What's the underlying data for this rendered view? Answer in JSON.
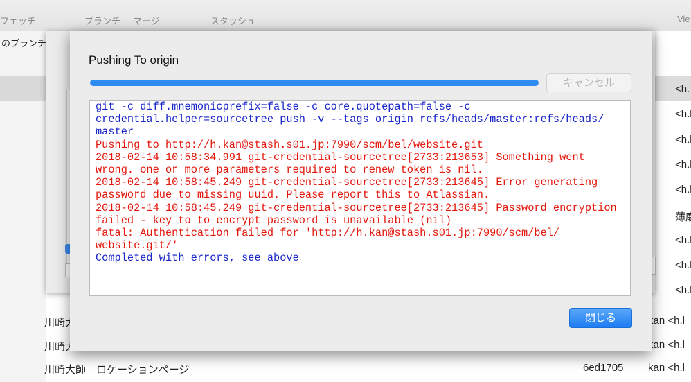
{
  "toolbar": {
    "fetch_label": "フェッチ",
    "branch_label": "ブランチ",
    "merge_label": "マージ",
    "stash_label": "スタッシュ",
    "view_label": "Vie"
  },
  "background": {
    "branch_header": "のブランチ",
    "right_authors": [
      "<h.",
      "<h.l",
      "<h.l",
      "<h.l",
      "<h.l",
      "薄磨",
      "<h.l",
      "<h.l",
      "<h.l",
      "<h.l"
    ],
    "commit_rows": [
      {
        "subject": "川崎大",
        "hash": "",
        "author": "kan <h.l"
      },
      {
        "subject": "川崎大",
        "hash": "",
        "author": "kan <h.l"
      },
      {
        "subject": "川崎大師　ロケーションページ",
        "hash": "6ed1705",
        "author": "kan <h.l"
      }
    ]
  },
  "dialog": {
    "title": "Pushing To origin",
    "progress": 1.0,
    "cancel_label": "キャンセル",
    "close_label": "閉じる",
    "log": [
      {
        "text": "git -c diff.mnemonicprefix=false -c core.quotepath=false -c",
        "color": "blue"
      },
      {
        "text": "credential.helper=sourcetree push -v --tags origin refs/heads/master:refs/heads/",
        "color": "blue"
      },
      {
        "text": "master",
        "color": "blue"
      },
      {
        "text": "Pushing to http://h.kan@stash.s01.jp:7990/scm/bel/website.git",
        "color": "red"
      },
      {
        "text": "2018-02-14 10:58:34.991 git-credential-sourcetree[2733:213653] Something went",
        "color": "red"
      },
      {
        "text": "wrong. one or more parameters required to renew token is nil.",
        "color": "red"
      },
      {
        "text": "2018-02-14 10:58:45.249 git-credential-sourcetree[2733:213645] Error generating",
        "color": "red"
      },
      {
        "text": "password due to missing uuid. Please report this to Atlassian.",
        "color": "red"
      },
      {
        "text": "2018-02-14 10:58:45.249 git-credential-sourcetree[2733:213645] Password encryption",
        "color": "red"
      },
      {
        "text": "failed - key to to encrypt password is unavailable (nil)",
        "color": "red"
      },
      {
        "text": "fatal: Authentication failed for 'http://h.kan@stash.s01.jp:7990/scm/bel/",
        "color": "red"
      },
      {
        "text": "website.git/'",
        "color": "red"
      },
      {
        "text": "Completed with errors, see above",
        "color": "blue"
      }
    ]
  },
  "colors": {
    "log_blue": "#1a26c9",
    "log_red": "#e4170c",
    "accent": "#2f8cf3"
  }
}
